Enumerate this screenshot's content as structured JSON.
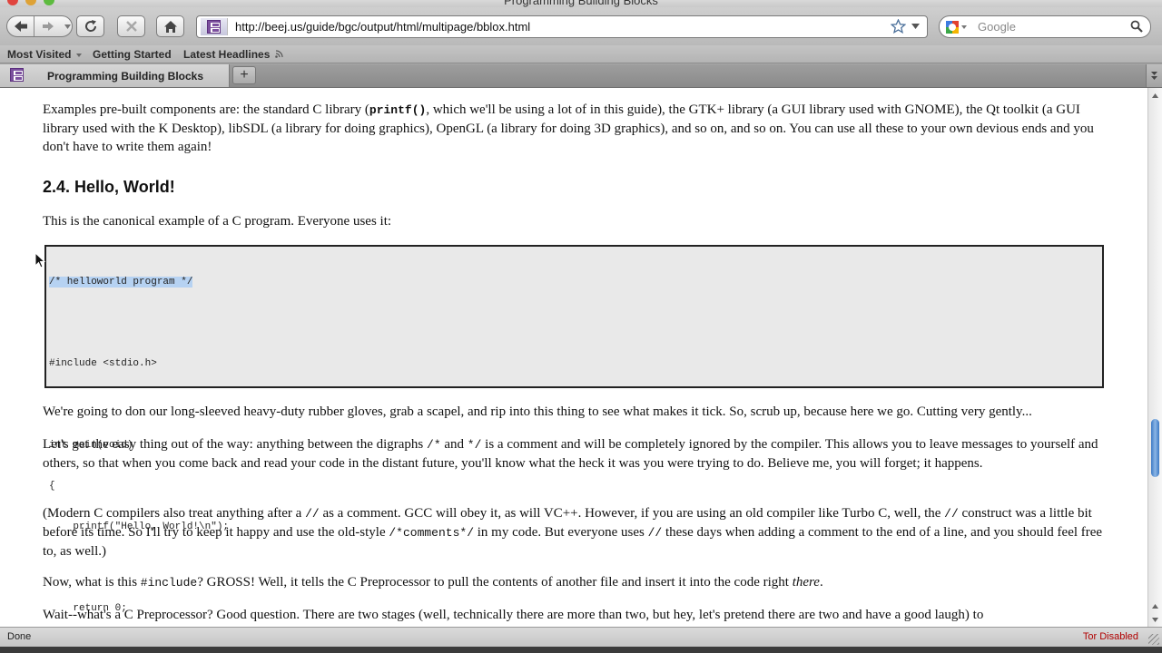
{
  "window": {
    "title": "Programming Building Blocks"
  },
  "toolbar": {
    "url": "http://beej.us/guide/bgc/output/html/multipage/bblox.html",
    "search_placeholder": "Google"
  },
  "bookmarks": [
    {
      "label": "Most Visited",
      "has_dropdown": true
    },
    {
      "label": "Getting Started"
    },
    {
      "label": "Latest Headlines",
      "has_feed_icon": true
    }
  ],
  "tabs": [
    {
      "label": "Programming Building Blocks",
      "active": true
    }
  ],
  "new_tab_label": "+",
  "content": {
    "intro_a": "Examples pre-built components are: the standard C library (",
    "intro_code": "printf()",
    "intro_b": ", which we'll be using a lot of in this guide), the GTK+ library (a GUI library used with GNOME), the Qt toolkit (a GUI library used with the K Desktop), libSDL (a library for doing graphics), OpenGL (a library for doing 3D graphics), and so on, and so on. You can use all these to your own devious ends and you don't have to write them again!",
    "heading": "2.4. Hello, World!",
    "canonical": "This is the canonical example of a C program. Everyone uses it:",
    "code_lines": [
      "/* helloworld program */",
      "",
      "#include <stdio.h>",
      "",
      "int main(void)",
      "{",
      "    printf(\"Hello, World!\\n\");",
      "",
      "    return 0;",
      "}"
    ],
    "gloves": "We're going to don our long-sleeved heavy-duty rubber gloves, grab a scapel, and rip into this thing to see what makes it tick. So, scrub up, because here we go. Cutting very gently...",
    "easy_a": "Let's get the easy thing out of the way: anything between the digraphs ",
    "easy_code1": "/*",
    "easy_and": " and ",
    "easy_code2": "*/",
    "easy_b": " is a comment and will be completely ignored by the compiler. This allows you to leave messages to yourself and others, so that when you come back and read your code in the distant future, you'll know what the heck it was you were trying to do. Believe me, you will forget; it happens.",
    "modern_a": "(Modern C compilers also treat anything after a ",
    "modern_code1": "//",
    "modern_b": " as a comment. GCC will obey it, as will VC++. However, if you are using an old compiler like Turbo C, well, the ",
    "modern_code2": "//",
    "modern_c": " construct was a little bit before its time. So I'll try to keep it happy and use the old-style ",
    "modern_code3": "/*comments*/",
    "modern_d": " in my code. But everyone uses ",
    "modern_code4": "//",
    "modern_e": " these days when adding a comment to the end of a line, and you should feel free to, as well.)",
    "include_a": "Now, what is this ",
    "include_code": "#include",
    "include_b": "? GROSS! Well, it tells the C Preprocessor to pull the contents of another file and insert it into the code right ",
    "include_em": "there",
    "include_c": ".",
    "wait": "Wait--what's a C Preprocessor? Good question. There are two stages (well, technically there are more than two, but hey, let's pretend there are two and have a good laugh) to"
  },
  "status": {
    "left": "Done",
    "right": "Tor Disabled"
  },
  "colors": {
    "accent": "#3c79c4",
    "selection": "#b6d2f2",
    "tor_status": "#b10000"
  },
  "icons": [
    "back-arrow-icon",
    "forward-arrow-icon",
    "reload-icon",
    "stop-icon",
    "home-icon",
    "bookmark-star-icon",
    "magnifier-icon",
    "rss-feed-icon",
    "mouse-cursor-icon"
  ]
}
